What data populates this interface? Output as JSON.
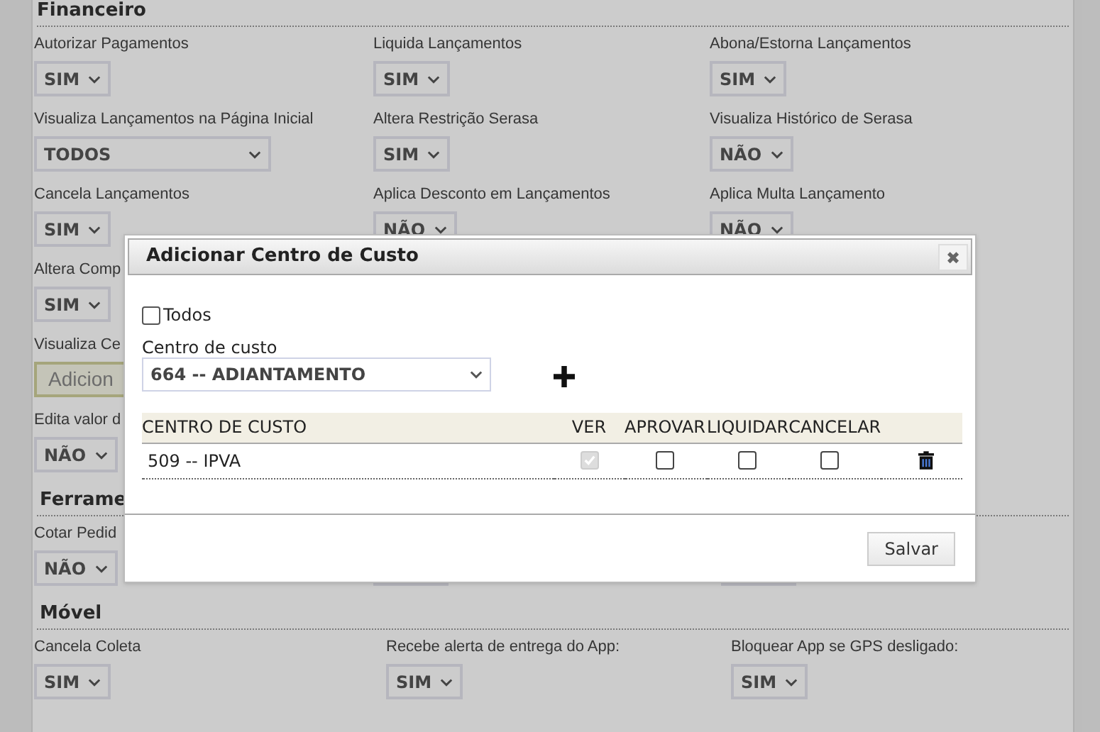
{
  "sections": [
    {
      "title": "Financeiro",
      "rows": [
        [
          {
            "label": "Autorizar Pagamentos",
            "kind": "select",
            "value": "SIM"
          },
          {
            "label": "Liquida Lançamentos",
            "kind": "select",
            "value": "SIM"
          },
          {
            "label": "Abona/Estorna Lançamentos",
            "kind": "select",
            "value": "SIM"
          }
        ],
        [
          {
            "label": "Visualiza Lançamentos na Página Inicial",
            "kind": "select",
            "value": "TODOS",
            "wide": true
          },
          {
            "label": "Altera Restrição Serasa",
            "kind": "select",
            "value": "SIM"
          },
          {
            "label": "Visualiza Histórico de Serasa",
            "kind": "select",
            "value": "NÃO"
          }
        ],
        [
          {
            "label": "Cancela Lançamentos",
            "kind": "select",
            "value": "SIM"
          },
          {
            "label": "Aplica Desconto em Lançamentos",
            "kind": "select",
            "value": "NÃO"
          },
          {
            "label": "Aplica Multa Lançamento",
            "kind": "select",
            "value": "NÃO"
          }
        ],
        [
          {
            "label": "Altera Comp",
            "kind": "select",
            "value": "SIM"
          }
        ],
        [
          {
            "label": "Visualiza Ce",
            "kind": "button",
            "value": "Adicion"
          }
        ],
        [
          {
            "label": "Edita valor d",
            "kind": "select",
            "value": "NÃO"
          }
        ]
      ]
    },
    {
      "title": "Ferrame",
      "rows": [
        [
          {
            "label": "Cotar Pedid",
            "kind": "select",
            "value": "NÃO"
          },
          {
            "kind": "select"
          },
          {
            "kind": "select"
          }
        ]
      ]
    },
    {
      "title": "Móvel",
      "rows": [
        [
          {
            "label": "Cancela Coleta",
            "kind": "select",
            "value": "SIM"
          },
          {
            "label": "Recebe alerta de entrega do App:",
            "kind": "select",
            "value": "SIM"
          },
          {
            "label": "Bloquear App se GPS desligado:",
            "kind": "select",
            "value": "SIM"
          }
        ]
      ]
    }
  ],
  "dialog": {
    "title": "Adicionar Centro de Custo",
    "close": "✖",
    "todos": {
      "label": "Todos",
      "checked": false
    },
    "field_label": "Centro de custo",
    "field_value": "664 -- ADIANTAMENTO",
    "table": {
      "columns": [
        "CENTRO DE CUSTO",
        "VER",
        "APROVAR",
        "LIQUIDAR",
        "CANCELAR"
      ],
      "rows": [
        [
          {
            "kind": "text",
            "text": "509 -- IPVA"
          },
          {
            "kind": "checkbox",
            "checked": true,
            "disabled": true
          },
          {
            "kind": "checkbox",
            "checked": false,
            "disabled": false
          },
          {
            "kind": "checkbox",
            "checked": false,
            "disabled": false
          },
          {
            "kind": "checkbox",
            "checked": false,
            "disabled": false
          },
          {
            "kind": "delete"
          }
        ]
      ]
    },
    "save": "Salvar"
  }
}
